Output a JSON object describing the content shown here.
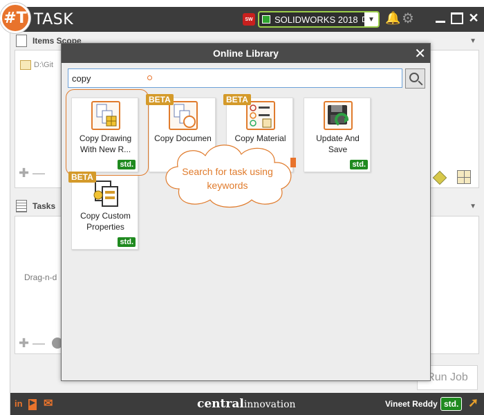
{
  "app": {
    "title": "TASK",
    "logo_text": "#T",
    "solidworks_version": "SOLIDWORKS 2018",
    "sw_icon_text": "SW"
  },
  "items_scope": {
    "header": "Items Scope",
    "path": "D:\\Git"
  },
  "tasks": {
    "header": "Tasks",
    "hint": "Drag-n-d"
  },
  "run_job_label": "Run Job",
  "footer": {
    "brand_bold": "central",
    "brand_light": "innovation",
    "user": "Vineet Reddy",
    "plan": "std."
  },
  "modal": {
    "title": "Online Library",
    "search_value": "copy",
    "callout": "Search for task using keywords",
    "cards": [
      {
        "label": "Copy Drawing With New R...",
        "badge": "std.",
        "beta": ""
      },
      {
        "label": "Copy Documen",
        "badge": "",
        "beta": "BETA"
      },
      {
        "label": "Copy Material",
        "badge": "",
        "beta": "BETA"
      },
      {
        "label": "Update And Save",
        "badge": "std.",
        "beta": ""
      },
      {
        "label": "Copy Custom Properties",
        "badge": "std.",
        "beta": "BETA"
      }
    ]
  },
  "colors": {
    "accent": "#e8732c",
    "std_green": "#1f8a1f",
    "beta_gold": "#d49a2a",
    "titlebar": "#3c3c3c"
  },
  "icons": [
    "bell-icon",
    "gear-icon",
    "search-icon",
    "linkedin-icon",
    "youtube-icon",
    "mail-icon",
    "arrow-up-icon"
  ]
}
